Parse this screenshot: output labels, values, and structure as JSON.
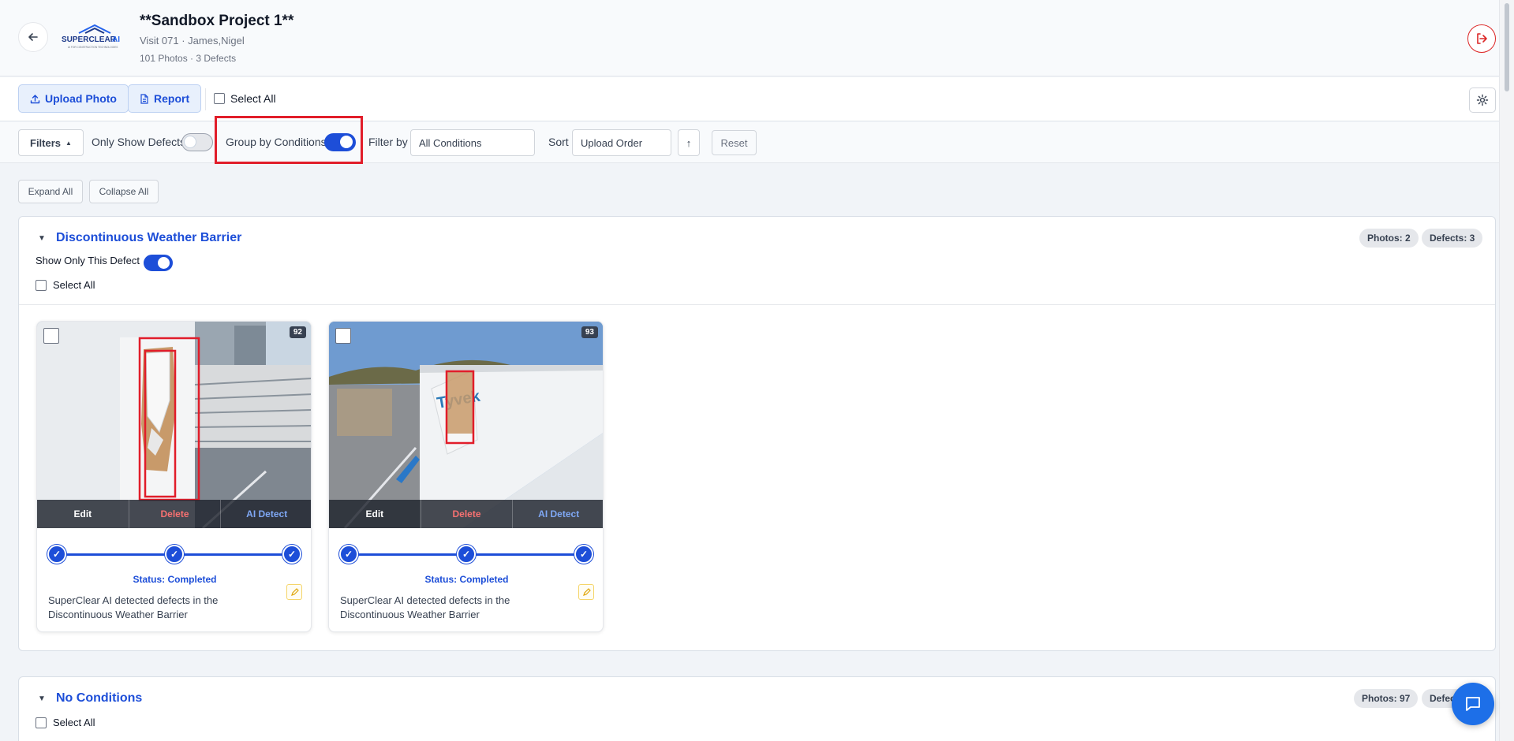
{
  "header": {
    "project_title": "**Sandbox Project 1**",
    "visit": "Visit 071 · James,Nigel",
    "counts": "101 Photos · 3 Defects",
    "logo_text": "SUPERCLEAR AI",
    "logo_tagline": "AI FOR CONSTRUCTION TECHNOLOGIES"
  },
  "toolbar": {
    "upload_label": "Upload Photo",
    "report_label": "Report",
    "select_all_label": "Select All"
  },
  "filterbar": {
    "filters_label": "Filters",
    "only_defects_label": "Only Show Defects",
    "only_defects_on": false,
    "group_by_label": "Group by Conditions",
    "group_by_on": true,
    "filter_by_label": "Filter by",
    "filter_by_value": "All Conditions",
    "sort_label": "Sort",
    "sort_value": "Upload Order",
    "sort_dir": "↑",
    "reset_label": "Reset"
  },
  "controls": {
    "expand_all": "Expand All",
    "collapse_all": "Collapse All"
  },
  "groups": [
    {
      "title": "Discontinuous Weather Barrier",
      "photos_badge": "Photos: 2",
      "defects_badge": "Defects: 3",
      "show_only_label": "Show Only This Defect",
      "show_only_on": true,
      "select_all_label": "Select All",
      "photos": [
        {
          "number": "92",
          "edit": "Edit",
          "delete": "Delete",
          "ai_detect": "AI Detect",
          "status": "Status: Completed",
          "description": "SuperClear AI detected defects in the Discontinuous Weather Barrier"
        },
        {
          "number": "93",
          "edit": "Edit",
          "delete": "Delete",
          "ai_detect": "AI Detect",
          "status": "Status: Completed",
          "description": "SuperClear AI detected defects in the Discontinuous Weather Barrier"
        }
      ]
    },
    {
      "title": "No Conditions",
      "photos_badge": "Photos: 97",
      "defects_badge": "Defects: 0",
      "select_all_label": "Select All"
    }
  ],
  "colors": {
    "accent": "#1d4ed8",
    "highlight": "#e11d2a",
    "danger": "#dc2626"
  }
}
